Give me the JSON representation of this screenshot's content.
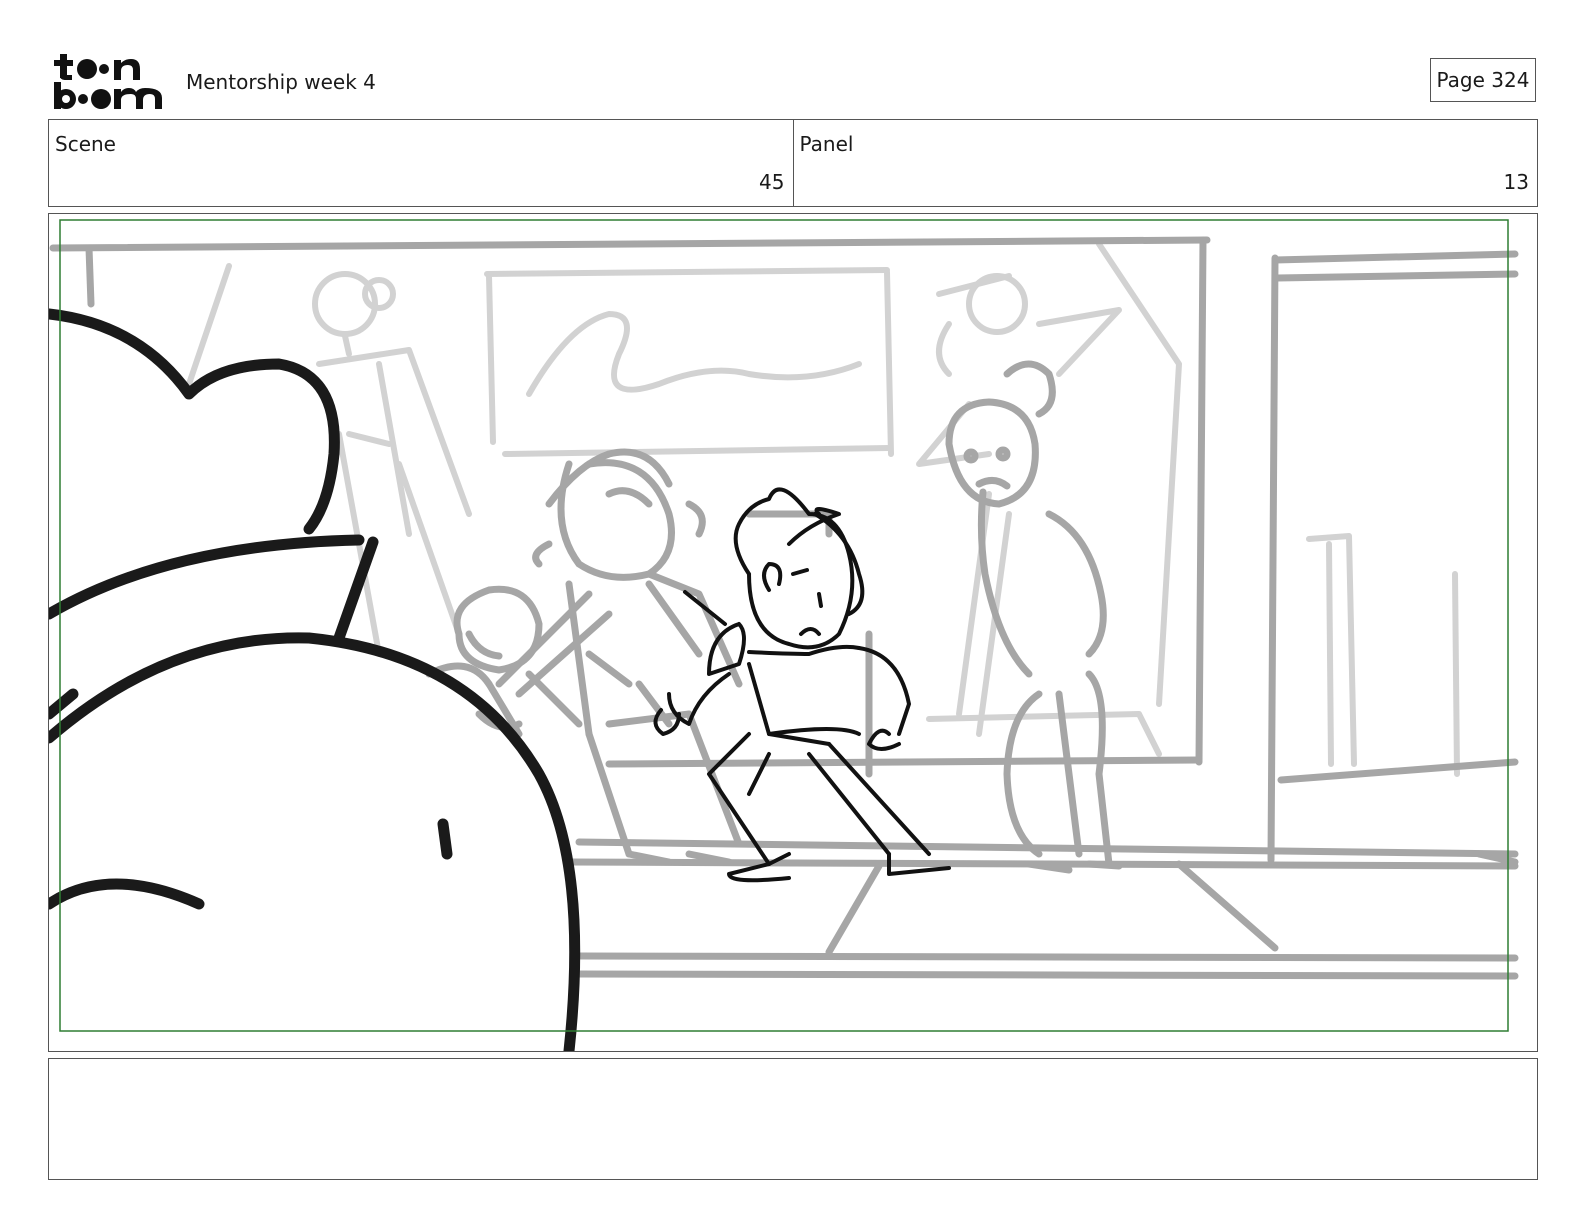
{
  "header": {
    "logo_text": "toonboom",
    "title": "Mentorship week 4",
    "page_label": "Page 324"
  },
  "info": {
    "scene_label": "Scene",
    "scene_value": "45",
    "panel_label": "Panel",
    "panel_value": "13"
  },
  "frame": {
    "safe_area_color": "#2e7d32",
    "background_line_color": "#9e9e9e",
    "light_line_color": "#cfcfcf",
    "ink_color": "#1a1a1a"
  },
  "notes": {
    "text": ""
  }
}
